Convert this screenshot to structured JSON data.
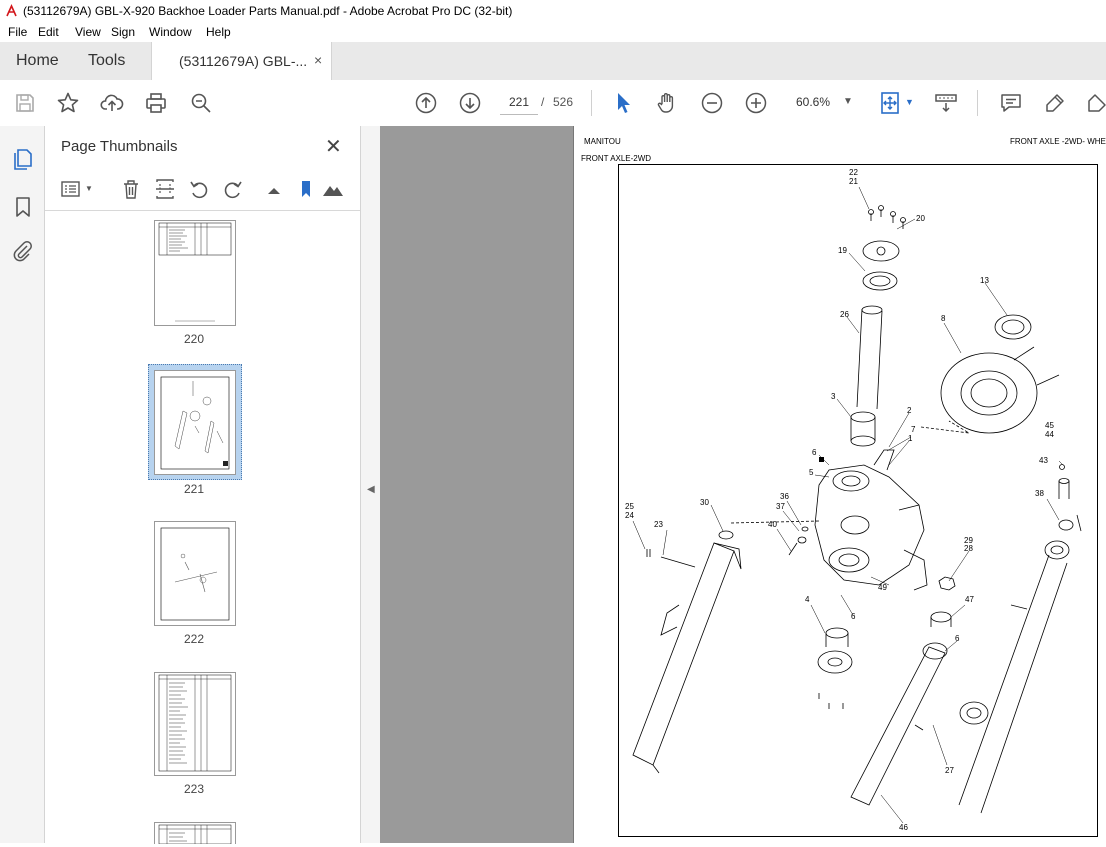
{
  "window": {
    "title": "(53112679A) GBL-X-920 Backhoe Loader Parts Manual.pdf - Adobe Acrobat Pro DC (32-bit)"
  },
  "menu": [
    "File",
    "Edit",
    "View",
    "Sign",
    "Window",
    "Help"
  ],
  "tabs": {
    "home": "Home",
    "tools": "Tools",
    "document": "(53112679A) GBL-...",
    "close_glyph": "×"
  },
  "toolbar": {
    "current_page": "221",
    "page_separator": "/",
    "total_pages": "526",
    "zoom": "60.6%",
    "icons": [
      "save-icon",
      "bookmark-star-icon",
      "upload-icon",
      "print-icon",
      "zoom-search-icon",
      "page-up-icon",
      "page-down-icon",
      "select-cursor-icon",
      "hand-icon",
      "zoom-out-icon",
      "zoom-in-icon",
      "fit-page-icon",
      "scroll-mode-icon",
      "comment-icon",
      "highlight-pen-icon",
      "sign-pen-icon"
    ]
  },
  "thumbnails": {
    "title": "Page Thumbnails",
    "pages": [
      {
        "label": "220",
        "selected": false
      },
      {
        "label": "221",
        "selected": true
      },
      {
        "label": "222",
        "selected": false
      },
      {
        "label": "223",
        "selected": false
      }
    ]
  },
  "document": {
    "header_left": "MANITOU",
    "header_right": "FRONT AXLE -2WD- WHE",
    "subheader": "FRONT AXLE-2WD",
    "callouts": [
      "22",
      "21",
      "20",
      "19",
      "13",
      "26",
      "8",
      "3",
      "2",
      "7",
      "1",
      "6",
      "5",
      "45",
      "44",
      "43",
      "38",
      "30",
      "36",
      "37",
      "25",
      "24",
      "23",
      "40",
      "29",
      "28",
      "49",
      "4",
      "6",
      "47",
      "6",
      "27",
      "46"
    ]
  },
  "colors": {
    "accent": "#2a6ec8",
    "selection": "#b7d3ef",
    "doc_background": "#9a9a9a",
    "acrobat_red": "#d3171c"
  }
}
